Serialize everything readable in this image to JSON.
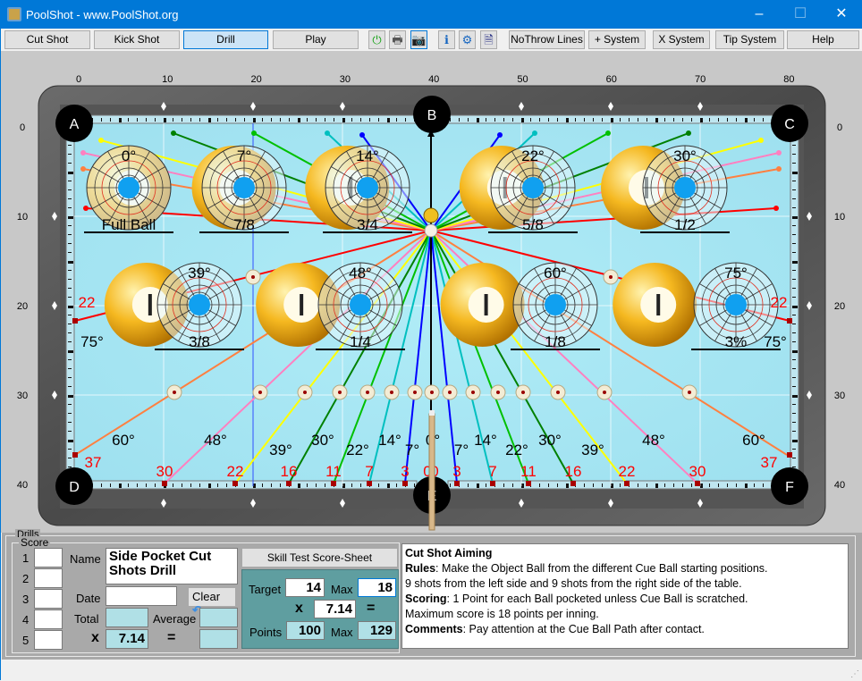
{
  "window": {
    "title": "PoolShot - www.PoolShot.org",
    "minimize": "–",
    "maximize": "☐",
    "close": "✕"
  },
  "toolbar": {
    "buttons": [
      "Cut Shot",
      "Kick Shot",
      "Drill",
      "Play"
    ],
    "selected": "Drill",
    "icons": [
      {
        "name": "power-icon",
        "glyph": "⏻",
        "color": "#1aa31a"
      },
      {
        "name": "print-icon",
        "glyph": "🖶",
        "color": "#555"
      },
      {
        "name": "camera-icon",
        "glyph": "📷",
        "color": "#000"
      },
      {
        "name": "info-icon",
        "glyph": "ℹ",
        "color": "#1565c0"
      },
      {
        "name": "settings-icon",
        "glyph": "⚙",
        "color": "#1565c0"
      },
      {
        "name": "help-doc-icon",
        "glyph": "🗎",
        "color": "#1a237e"
      }
    ],
    "right_buttons": [
      "NoThrow Lines",
      "+ System",
      "X System",
      "Tip System",
      "Help"
    ]
  },
  "table": {
    "x_ticks": [
      "0",
      "10",
      "20",
      "30",
      "40",
      "50",
      "60",
      "70",
      "80"
    ],
    "y_ticks": [
      "0",
      "10",
      "20",
      "30",
      "40"
    ],
    "pockets": [
      "A",
      "B",
      "C",
      "D",
      "E",
      "F"
    ],
    "ghost_balls": [
      {
        "angle": "0°",
        "fraction": "Full Ball",
        "deg": 0
      },
      {
        "angle": "7°",
        "fraction": "7/8",
        "deg": 7
      },
      {
        "angle": "14°",
        "fraction": "3/4",
        "deg": 14
      },
      {
        "angle": "22°",
        "fraction": "5/8",
        "deg": 22
      },
      {
        "angle": "30°",
        "fraction": "1/2",
        "deg": 30
      },
      {
        "angle": "39°",
        "fraction": "3/8",
        "deg": 39
      },
      {
        "angle": "48°",
        "fraction": "1/4",
        "deg": 48
      },
      {
        "angle": "60°",
        "fraction": "1/8",
        "deg": 60
      },
      {
        "angle": "75°",
        "fraction": "3%",
        "deg": 75
      }
    ],
    "line_colors": {
      "0": "#000000",
      "3": "#0000ff",
      "7": "#00bfbf",
      "11": "#00c000",
      "16": "#008000",
      "22": "#ffff00",
      "30": "#ff80c0",
      "37": "#ff8040",
      "side": "#ff0000"
    },
    "rail_numbers_left": [
      "37",
      "30",
      "22",
      "16",
      "11",
      "7",
      "3",
      "0"
    ],
    "rail_numbers_right": [
      "0",
      "3",
      "7",
      "11",
      "16",
      "22",
      "30",
      "37"
    ],
    "side_number": "22",
    "side_angle": "75°",
    "angle_labels_left": [
      "60°",
      "48°",
      "39°",
      "30°",
      "22°",
      "14°",
      "7°",
      "0°"
    ],
    "angle_labels_right": [
      "7°",
      "14°",
      "22°",
      "30°",
      "39°",
      "48°",
      "60°"
    ],
    "cloth_color": "#9ee0ef"
  },
  "drills": {
    "group_label": "Drills",
    "score_label": "Score",
    "rows": [
      "1",
      "2",
      "3",
      "4",
      "5"
    ],
    "name_label": "Name",
    "name_value": "Side Pocket Cut Shots Drill",
    "date_label": "Date",
    "date_value": "",
    "clear_label": "Clear",
    "total_label": "Total",
    "average_label": "Average",
    "x_label": "x",
    "multiplier": "7.14",
    "equals": "=",
    "score_sheet_button": "Skill Test Score-Sheet",
    "target_label": "Target",
    "target_value": "14",
    "max_label": "Max",
    "max_value": "18",
    "mult_value": "7.14",
    "points_label": "Points",
    "points_value": "100",
    "points_max": "129"
  },
  "description": {
    "title": "Cut Shot Aiming",
    "rules_label": "Rules",
    "rules": ": Make the Object Ball from the different Cue Ball starting positions.",
    "rules2": "9 shots from the left side and 9 shots from the right side of the table.",
    "scoring_label": "Scoring",
    "scoring": ": 1 Point for each Ball pocketed unless Cue Ball is scratched.",
    "scoring2": "Maximum score is 18 points per inning.",
    "comments_label": "Comments",
    "comments": ": Pay attention at the Cue Ball Path after contact."
  }
}
